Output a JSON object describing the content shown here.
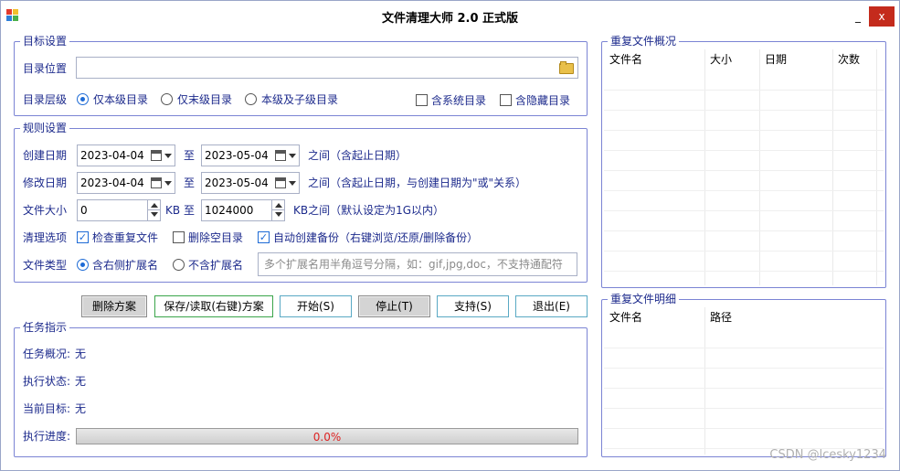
{
  "window": {
    "title": "文件清理大师 2.0 正式版",
    "min_label": "_",
    "close_label": "x"
  },
  "target": {
    "legend": "目标设置",
    "dir_label": "目录位置",
    "dir_value": "",
    "level_label": "目录层级",
    "level_options": [
      "仅本级目录",
      "仅末级目录",
      "本级及子级目录"
    ],
    "level_selected": 0,
    "include_system": {
      "label": "含系统目录",
      "checked": false
    },
    "include_hidden": {
      "label": "含隐藏目录",
      "checked": false
    }
  },
  "rules": {
    "legend": "规则设置",
    "created_label": "创建日期",
    "created_from": "2023-04-04",
    "created_to": "2023-05-04",
    "to_word": "至",
    "created_note": "之间（含起止日期）",
    "modified_label": "修改日期",
    "modified_from": "2023-04-04",
    "modified_to": "2023-05-04",
    "modified_note": "之间（含起止日期，与创建日期为\"或\"关系）",
    "size_label": "文件大小",
    "size_min": "0",
    "size_unit": "KB",
    "size_max": "1024000",
    "size_note": "KB之间（默认设定为1G以内）",
    "clean_label": "清理选项",
    "opt_dup": {
      "label": "检查重复文件",
      "checked": true
    },
    "opt_empty": {
      "label": "删除空目录",
      "checked": false
    },
    "opt_backup": {
      "label": "自动创建备份（右键浏览/还原/删除备份）",
      "checked": true
    },
    "type_label": "文件类型",
    "type_options": [
      "含右侧扩展名",
      "不含扩展名"
    ],
    "type_selected": 0,
    "ext_placeholder": "多个扩展名用半角逗号分隔，如：gif,jpg,doc，不支持通配符"
  },
  "buttons": {
    "delete_plan": "删除方案",
    "save_load_plan": "保存/读取(右键)方案",
    "start": "开始(S)",
    "stop": "停止(T)",
    "support": "支持(S)",
    "exit": "退出(E)"
  },
  "task": {
    "legend": "任务指示",
    "overview_label": "任务概况:",
    "overview_value": "无",
    "status_label": "执行状态:",
    "status_value": "无",
    "current_label": "当前目标:",
    "current_value": "无",
    "progress_label": "执行进度:",
    "progress_text": "0.0%",
    "progress_fraction": 0.0
  },
  "dup_overview": {
    "legend": "重复文件概况",
    "columns": [
      "文件名",
      "大小",
      "日期",
      "次数"
    ],
    "rows": []
  },
  "dup_detail": {
    "legend": "重复文件明细",
    "columns": [
      "文件名",
      "路径"
    ],
    "rows": []
  },
  "watermark": "CSDN @lcesky1234",
  "colors": {
    "label_blue": "#1c2a8c",
    "group_border": "#7b84d4",
    "close_red": "#c42b1c",
    "progress_text": "#dd2222"
  }
}
